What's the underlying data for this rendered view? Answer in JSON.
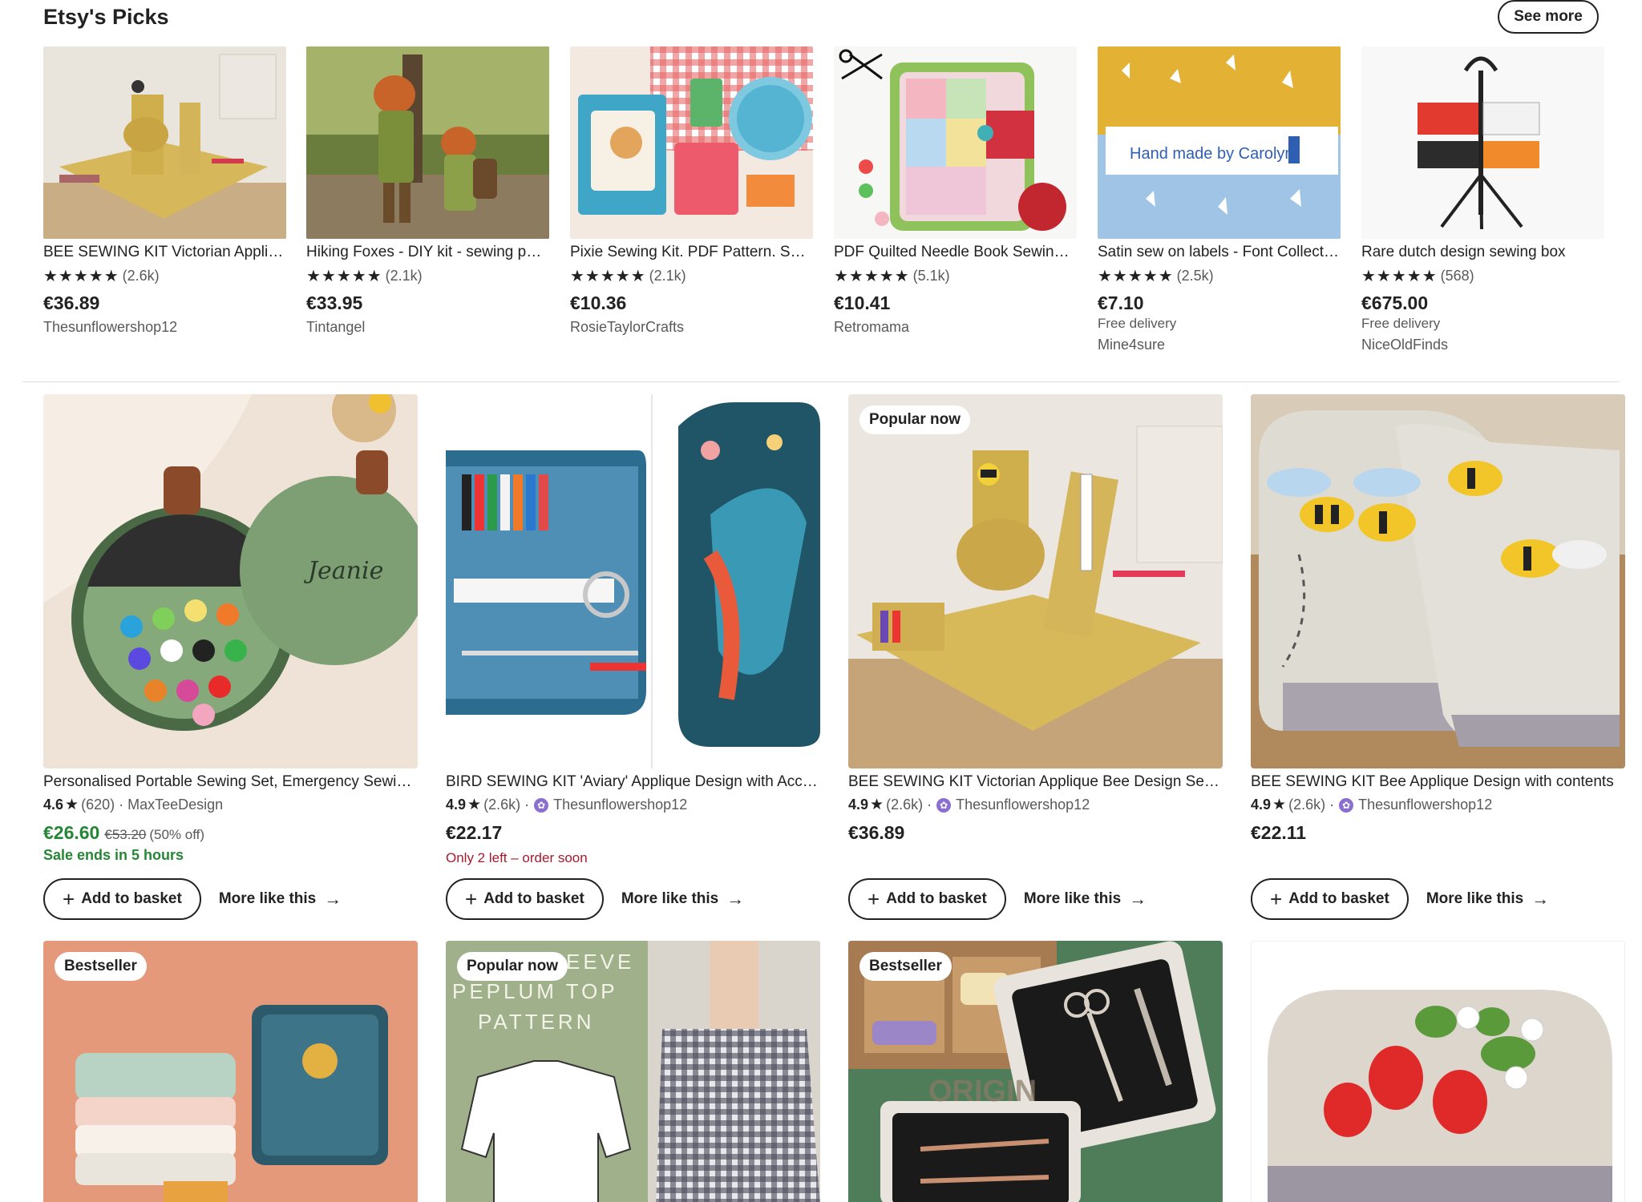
{
  "section": {
    "title": "Etsy's Picks",
    "see_more": "See more"
  },
  "picks": [
    {
      "title": "BEE SEWING KIT Victorian Applique Bee Design",
      "stars": "★★★★★",
      "reviews": "(2.6k)",
      "price": "€36.89",
      "delivery": "",
      "shop": "Thesunflowershop12"
    },
    {
      "title": "Hiking Foxes - DIY kit - sewing pattern",
      "stars": "★★★★★",
      "reviews": "(2.1k)",
      "price": "€33.95",
      "delivery": "",
      "shop": "Tintangel"
    },
    {
      "title": "Pixie Sewing Kit. PDF Pattern. Sewing case",
      "stars": "★★★★★",
      "reviews": "(2.1k)",
      "price": "€10.36",
      "delivery": "",
      "shop": "RosieTaylorCrafts"
    },
    {
      "title": "PDF Quilted Needle Book Sewing Pattern",
      "stars": "★★★★★",
      "reviews": "(5.1k)",
      "price": "€10.41",
      "delivery": "",
      "shop": "Retromama"
    },
    {
      "title": "Satin sew on labels - Font Collection",
      "stars": "★★★★★",
      "reviews": "(2.5k)",
      "price": "€7.10",
      "delivery": "Free delivery",
      "shop": "Mine4sure"
    },
    {
      "title": "Rare dutch design sewing box",
      "stars": "★★★★★",
      "reviews": "(568)",
      "price": "€675.00",
      "delivery": "Free delivery",
      "shop": "NiceOldFinds"
    }
  ],
  "listings": [
    {
      "badge": "",
      "title": "Personalised Portable Sewing Set, Emergency Sewing Kit",
      "rating": "4.6",
      "reviews": "(620)",
      "star_seller": false,
      "shop": "MaxTeeDesign",
      "price": "€26.60",
      "orig_price": "€53.20",
      "discount": "(50% off)",
      "sale_note": "Sale ends in 5 hours",
      "stock_note": "",
      "add_label": "Add to basket",
      "more_label": "More like this"
    },
    {
      "badge": "",
      "title": "BIRD SEWING KIT 'Aviary' Applique Design with Accessories",
      "rating": "4.9",
      "reviews": "(2.6k)",
      "star_seller": true,
      "shop": "Thesunflowershop12",
      "price": "€22.17",
      "orig_price": "",
      "discount": "",
      "sale_note": "",
      "stock_note": "Only 2 left – order soon",
      "add_label": "Add to basket",
      "more_label": "More like this"
    },
    {
      "badge": "Popular now",
      "title": "BEE SEWING KIT Victorian Applique Bee Design Sewing Box",
      "rating": "4.9",
      "reviews": "(2.6k)",
      "star_seller": true,
      "shop": "Thesunflowershop12",
      "price": "€36.89",
      "orig_price": "",
      "discount": "",
      "sale_note": "",
      "stock_note": "",
      "add_label": "Add to basket",
      "more_label": "More like this"
    },
    {
      "badge": "",
      "title": "BEE SEWING KIT Bee Applique Design with contents",
      "rating": "4.9",
      "reviews": "(2.6k)",
      "star_seller": true,
      "shop": "Thesunflowershop12",
      "price": "€22.11",
      "orig_price": "",
      "discount": "",
      "sale_note": "",
      "stock_note": "",
      "add_label": "Add to basket",
      "more_label": "More like this"
    }
  ],
  "row3": [
    {
      "badge": "Bestseller"
    },
    {
      "badge": "Popular now",
      "image_text": [
        "EEVE",
        "PEPLUM TOP",
        "PATTERN"
      ]
    },
    {
      "badge": "Bestseller",
      "image_text": [
        "ORIGIN"
      ]
    },
    {
      "badge": ""
    }
  ],
  "label_text": "Hand made by Carolyn",
  "colors": {
    "sale_green": "#258635",
    "low_stock_red": "#a61a2e",
    "star_seller_purple": "#8b6fd0"
  }
}
